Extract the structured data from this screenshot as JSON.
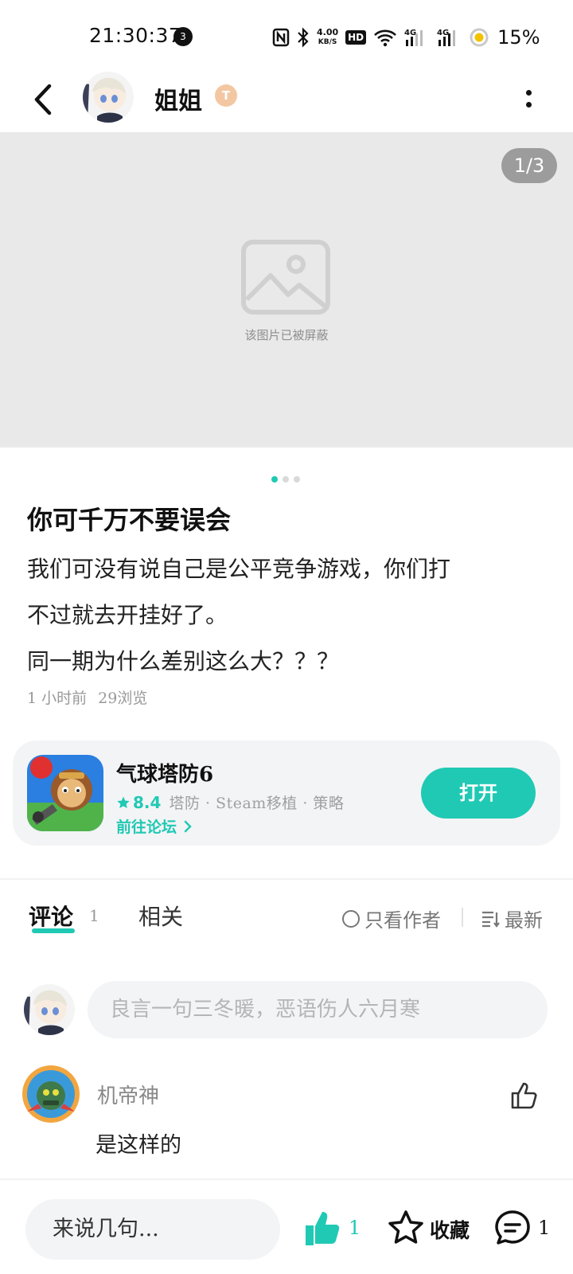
{
  "status_bar": {
    "time": "21:30:37",
    "notification_count": "3",
    "net_speed_value": "4.00",
    "net_speed_unit": "KB/S",
    "hd_label": "HD",
    "battery": "15%",
    "icons": [
      "nfc-icon",
      "bluetooth-icon",
      "wifi-icon",
      "signal-4g-icon",
      "signal-4g-icon",
      "battery-saver-icon"
    ]
  },
  "header": {
    "author_name": "姐姐",
    "level_badge": "T",
    "icons": [
      "back-icon",
      "more-icon"
    ]
  },
  "gallery": {
    "page_indicator": "1/3",
    "blocked_text": "该图片已被屏蔽",
    "pages_total": 3,
    "active_page": 1
  },
  "post": {
    "title": "你可千万不要误会",
    "body_lines": [
      "我们可没有说自己是公平竞争游戏，你们打",
      "不过就去开挂好了。",
      "同一期为什么差别这么大？？？"
    ],
    "time_ago": "1 小时前",
    "views": "29浏览"
  },
  "game": {
    "name": "气球塔防6",
    "score": "8.4",
    "tags": "塔防 · Steam移植 · 策略",
    "forum_link": "前往论坛",
    "open_button": "打开"
  },
  "tabs": {
    "comments_label": "评论",
    "comments_count": "1",
    "related_label": "相关",
    "author_only": "只看作者",
    "sort_label": "最新"
  },
  "comment_input": {
    "placeholder": "良言一句三冬暖，恶语伤人六月寒"
  },
  "comments": [
    {
      "user": "机帝神",
      "text": "是这样的"
    }
  ],
  "bottom_bar": {
    "input_placeholder": "来说几句...",
    "like_count": "1",
    "favorite_label": "收藏",
    "comment_count": "1"
  },
  "colors": {
    "accent": "#20c9b4",
    "image_bg": "#e9e9e9",
    "card_bg": "#f3f4f6",
    "muted_text": "#999999"
  }
}
